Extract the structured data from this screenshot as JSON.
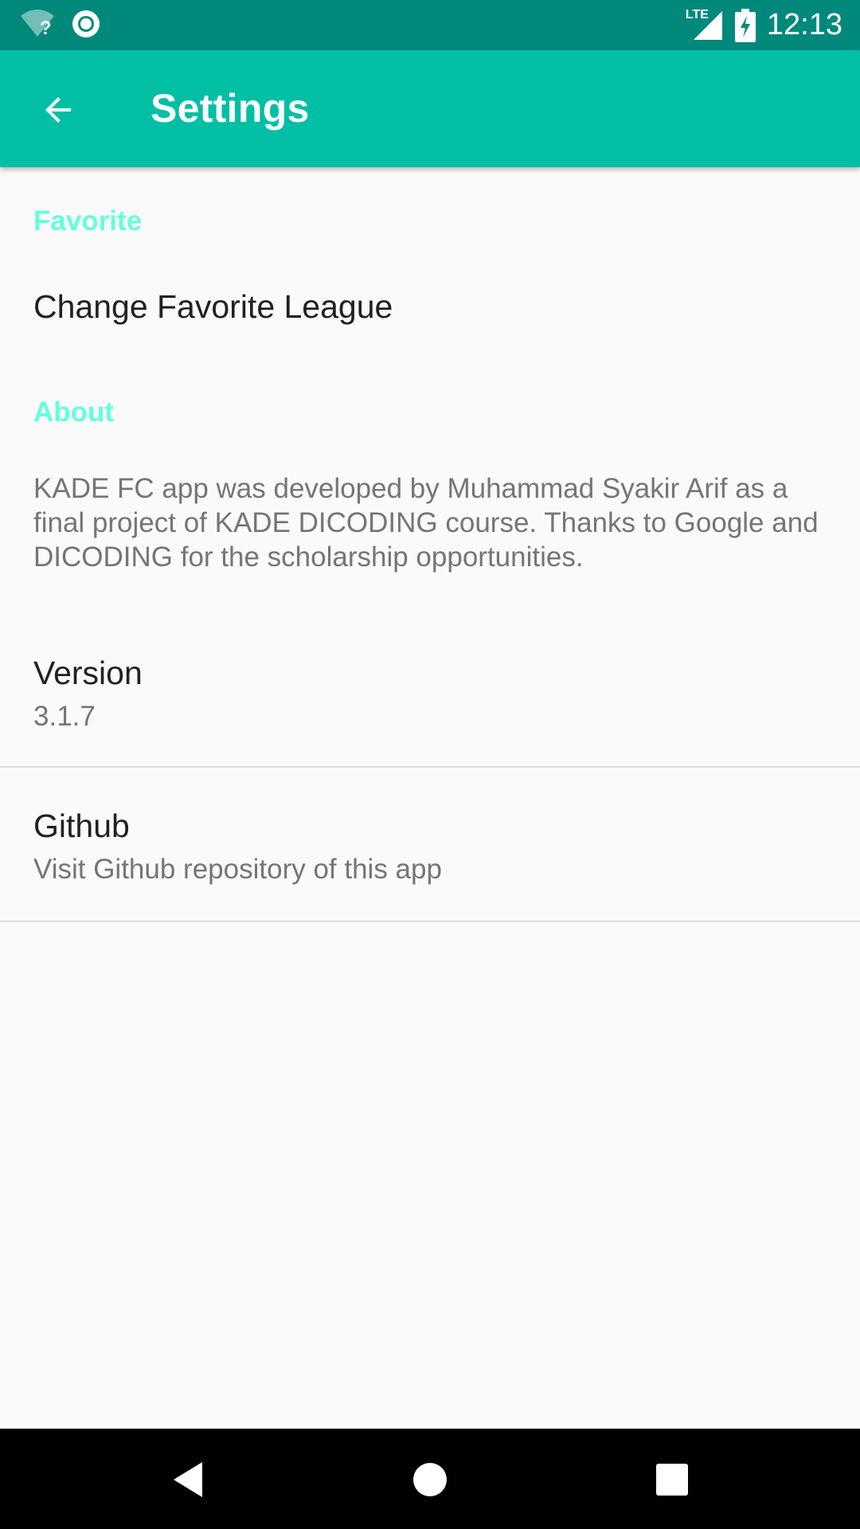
{
  "status_bar": {
    "time": "12:13",
    "network_label": "LTE",
    "wifi_unknown_mark": "?",
    "icons": [
      "wifi-unknown-icon",
      "sync-circle-icon",
      "lte-signal-icon",
      "battery-charging-icon"
    ]
  },
  "app_bar": {
    "title": "Settings",
    "back_icon": "arrow-back-icon",
    "color": "#00bfa5"
  },
  "categories": {
    "favorite": "Favorite",
    "about": "About",
    "accent": "#64ffda"
  },
  "preferences": {
    "change_favorite_league": {
      "title": "Change Favorite League"
    },
    "about_text": "KADE FC app was developed by Muhammad Syakir Arif as a final project of KADE DICODING course. Thanks to Google and DICODING for the scholarship opportunities.",
    "version": {
      "title": "Version",
      "summary": "3.1.7"
    },
    "github": {
      "title": "Github",
      "summary": "Visit Github repository of this app"
    }
  },
  "nav_bar": {
    "icons": [
      "back-triangle-icon",
      "home-circle-icon",
      "recents-square-icon"
    ]
  }
}
